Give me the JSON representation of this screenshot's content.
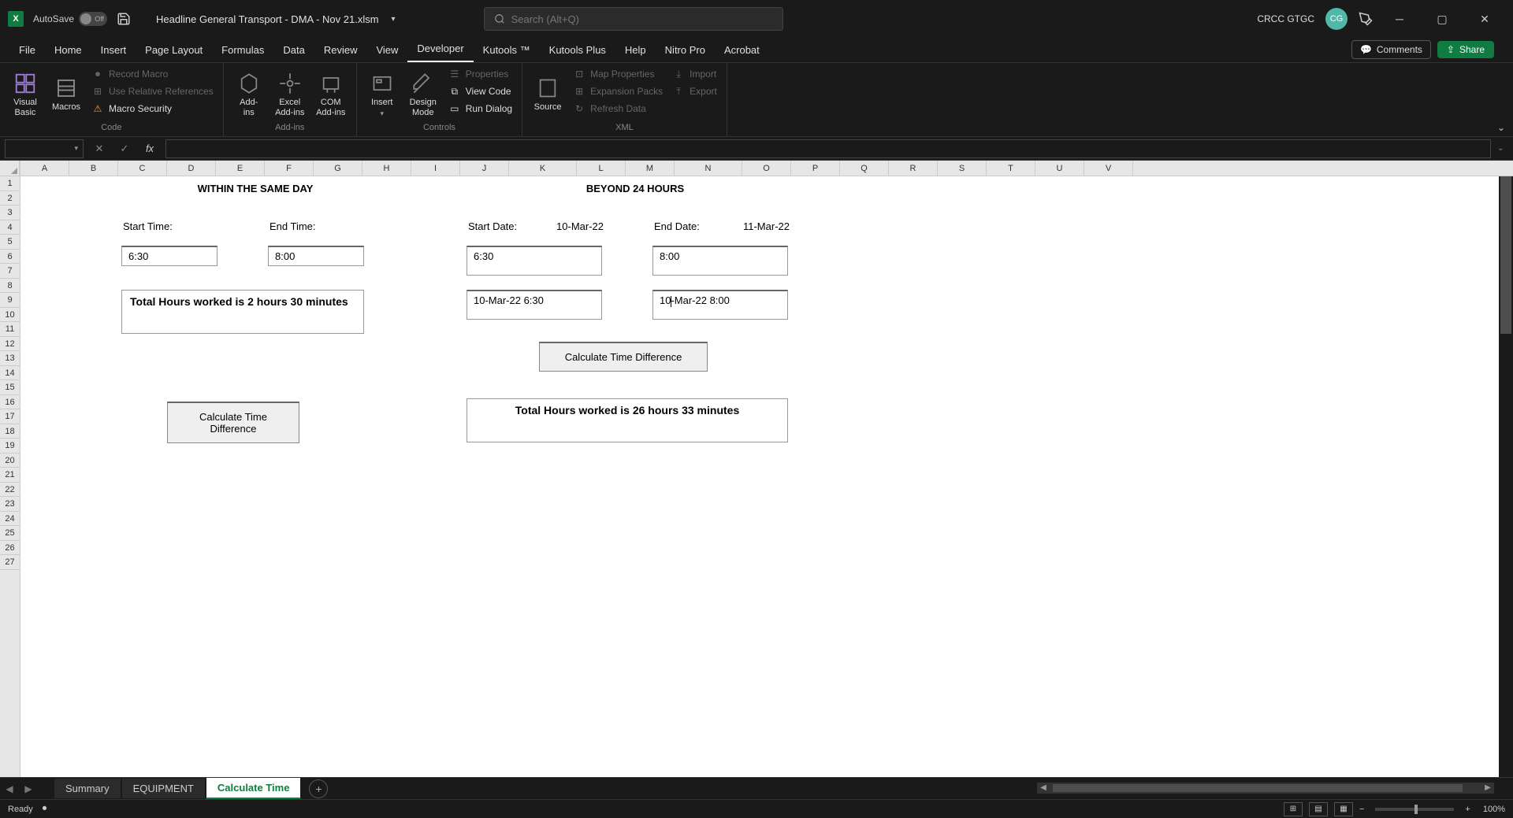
{
  "title_bar": {
    "autosave_label": "AutoSave",
    "autosave_state": "Off",
    "file_name": "Headline General Transport - DMA - Nov 21.xlsm",
    "search_placeholder": "Search (Alt+Q)",
    "user_name": "CRCC GTGC",
    "user_initials": "CG"
  },
  "ribbon_tabs": [
    "File",
    "Home",
    "Insert",
    "Page Layout",
    "Formulas",
    "Data",
    "Review",
    "View",
    "Developer",
    "Kutools ™",
    "Kutools Plus",
    "Help",
    "Nitro Pro",
    "Acrobat"
  ],
  "active_tab_index": 8,
  "comments_label": "Comments",
  "share_label": "Share",
  "ribbon": {
    "code": {
      "visual_basic": "Visual\nBasic",
      "macros": "Macros",
      "record_macro": "Record Macro",
      "use_relative": "Use Relative References",
      "macro_security": "Macro Security",
      "group_label": "Code"
    },
    "addins": {
      "addins": "Add-\nins",
      "excel_addins": "Excel\nAdd-ins",
      "com_addins": "COM\nAdd-ins",
      "group_label": "Add-ins"
    },
    "controls": {
      "insert": "Insert",
      "design_mode": "Design\nMode",
      "properties": "Properties",
      "view_code": "View Code",
      "run_dialog": "Run Dialog",
      "group_label": "Controls"
    },
    "xml": {
      "source": "Source",
      "map_properties": "Map Properties",
      "expansion_packs": "Expansion Packs",
      "refresh_data": "Refresh Data",
      "import": "Import",
      "export": "Export",
      "group_label": "XML"
    }
  },
  "columns": [
    "A",
    "B",
    "C",
    "D",
    "E",
    "F",
    "G",
    "H",
    "I",
    "J",
    "K",
    "L",
    "M",
    "N",
    "O",
    "P",
    "Q",
    "R",
    "S",
    "T",
    "U",
    "V"
  ],
  "sheet": {
    "section1_title": "WITHIN THE SAME DAY",
    "section2_title": "BEYOND 24 HOURS",
    "start_time_label": "Start Time:",
    "end_time_label": "End Time:",
    "start_date_label": "Start Date:",
    "end_date_label": "End Date:",
    "start_date_value": "10-Mar-22",
    "end_date_value": "11-Mar-22",
    "same_day_start": "6:30",
    "same_day_end": "8:00",
    "beyond_start": "6:30",
    "beyond_end": "8:00",
    "beyond_start_full": "10-Mar-22 6:30",
    "beyond_end_full": "10-Mar-22 8:00",
    "result1": "Total Hours worked is 2 hours 30 minutes",
    "result2": "Total Hours worked is 26 hours 33 minutes",
    "calc_btn": "Calculate Time Difference"
  },
  "sheet_tabs": [
    "Summary",
    "EQUIPMENT",
    "Calculate Time"
  ],
  "active_sheet_index": 2,
  "status": {
    "ready": "Ready",
    "zoom": "100%"
  }
}
